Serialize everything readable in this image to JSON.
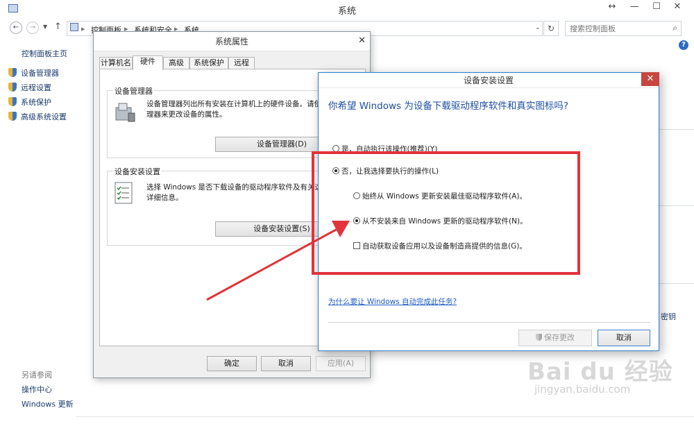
{
  "main_window": {
    "title": "系统",
    "controls": {
      "restore": "↔",
      "minimize": "—",
      "maximize": "☐",
      "close": "✕"
    },
    "address": {
      "root": "控制面板",
      "sep": "▸",
      "level1": "系统和安全",
      "level2": "系统"
    },
    "search_placeholder": "搜索控制面板",
    "help": "?"
  },
  "sidebar": {
    "home": "控制面板主页",
    "items": [
      {
        "label": "设备管理器",
        "icon": "shield-icon"
      },
      {
        "label": "远程设置",
        "icon": "shield-icon"
      },
      {
        "label": "系统保护",
        "icon": "shield-icon"
      },
      {
        "label": "高级系统设置",
        "icon": "shield-icon"
      }
    ],
    "see_also": "另请参阅",
    "links": [
      "操作中心",
      "Windows 更新"
    ]
  },
  "right_fragment": "密钥",
  "system_properties": {
    "title": "系统属性",
    "close": "✕",
    "tabs": [
      "计算机名",
      "硬件",
      "高级",
      "系统保护",
      "远程"
    ],
    "active_tab": "硬件",
    "device_manager": {
      "label": "设备管理器",
      "text1": "设备管理器列出所有安装在计算机上的硬件设备。请使用设",
      "text2": "理器来更改设备的属性。",
      "button": "设备管理器(D)"
    },
    "device_install": {
      "label": "设备安装设置",
      "text1": "选择 Windows 是否下载设备的驱动程序软件及有关这些",
      "text2": "详细信息。",
      "button": "设备安装设置(S)"
    },
    "ok": "确定",
    "cancel": "取消",
    "apply": "应用(A)"
  },
  "device_install_settings": {
    "title": "设备安装设置",
    "close": "✕",
    "question": "你希望 Windows 为设备下载驱动程序软件和真实图标吗?",
    "opt_yes": "是，自动执行该操作(推荐)(Y)",
    "opt_no": "否，让我选择要执行的操作(L)",
    "sub_always": "始终从 Windows 更新安装最佳驱动程序软件(A)。",
    "sub_never": "从不安装来自 Windows 更新的驱动程序软件(N)。",
    "check_auto": "自动获取设备应用以及设备制造商提供的信息(G)。",
    "help_link": "为什么要让 Windows 自动完成此任务?",
    "save": "保存更改",
    "cancel": "取消"
  },
  "watermark": {
    "main": "Bai du 经验",
    "sub": "jingyan.baidu.com"
  },
  "colors": {
    "annotation_red": "#e2333a",
    "link_blue": "#1e5bc6",
    "question_blue": "#1f4fa0",
    "close_red": "#c7463f"
  }
}
